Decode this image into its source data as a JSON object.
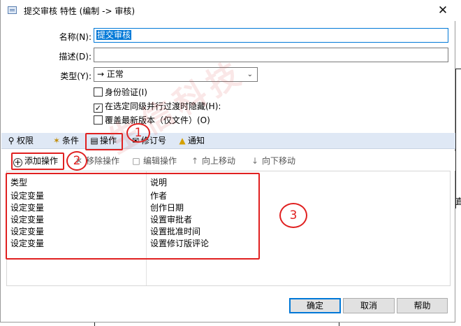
{
  "window": {
    "title": "提交审核 特性 (编制 -> 审核)",
    "close_glyph": "✕"
  },
  "form": {
    "name_label": "名称(N):",
    "name_value": "提交审核",
    "desc_label": "描述(D):",
    "desc_value": "",
    "type_label": "类型(Y):",
    "type_value": "→ 正常",
    "checkboxes": [
      {
        "label": "身份验证(I)",
        "checked": false
      },
      {
        "label": "在选定同级并行过渡时隐藏(H):",
        "checked": true
      },
      {
        "label": "覆盖最新版本（仅文件）(O)",
        "checked": false
      }
    ]
  },
  "tabs": [
    {
      "label": "权限",
      "icon": "key-icon"
    },
    {
      "label": "条件",
      "icon": "condition-wand-icon"
    },
    {
      "label": "操作",
      "icon": "action-document-icon",
      "active": true
    },
    {
      "label": "修订号",
      "icon": "revision-icon"
    },
    {
      "label": "通知",
      "icon": "bell-icon"
    }
  ],
  "toolbar": {
    "add": "添加操作",
    "remove": "移除操作",
    "edit": "编辑操作",
    "up": "向上移动",
    "down": "向下移动"
  },
  "list": {
    "col_type": "类型",
    "col_desc": "说明",
    "rows": [
      {
        "type": "设定变量",
        "desc": "作者"
      },
      {
        "type": "设定变量",
        "desc": "创作日期"
      },
      {
        "type": "设定变量",
        "desc": "设置审批者"
      },
      {
        "type": "设定变量",
        "desc": "设置批准时间"
      },
      {
        "type": "设定变量",
        "desc": "设置修订版评论"
      }
    ]
  },
  "annotations": [
    "1",
    "2",
    "3"
  ],
  "buttons": {
    "ok": "确定",
    "cancel": "取消",
    "help": "帮助"
  },
  "background_text": "直",
  "watermark": "生信科技",
  "colors": {
    "tab_bar": "#dfe8f5",
    "annotation_red": "#e02020",
    "selection_blue": "#0078d7"
  }
}
